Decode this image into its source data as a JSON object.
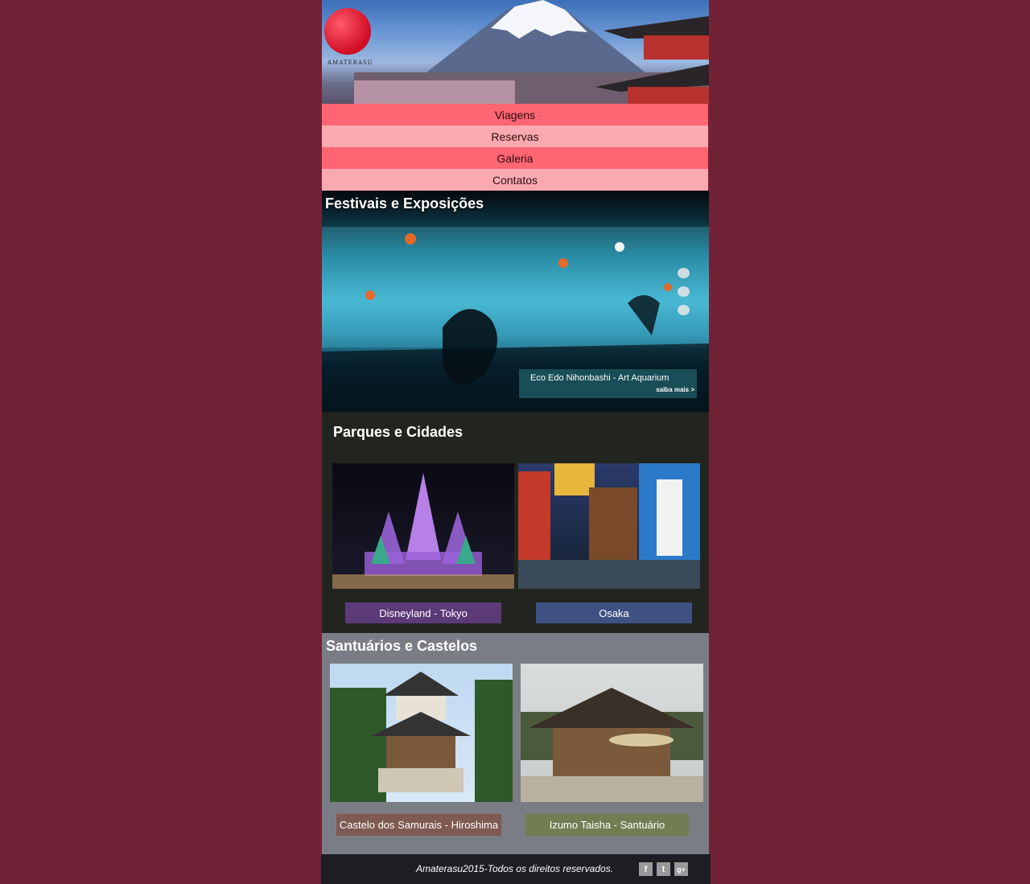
{
  "header": {
    "logo_text": "AMATERASU"
  },
  "nav": [
    {
      "label": "Viagens"
    },
    {
      "label": "Reservas"
    },
    {
      "label": "Galeria"
    },
    {
      "label": "Contatos"
    }
  ],
  "festivals": {
    "title": "Festivais e Exposições",
    "caption_title": "Eco Edo Nihonbashi - Art Aquarium",
    "caption_link": "saiba mais >"
  },
  "parks": {
    "title": "Parques e Cidades",
    "items": [
      {
        "label": "Disneyland - Tokyo",
        "color": "#5c3a78"
      },
      {
        "label": "Osaka",
        "color": "#3e5182"
      }
    ]
  },
  "shrines": {
    "title": "Santuários e Castelos",
    "items": [
      {
        "label": "Castelo dos Samurais - Hiroshima",
        "color": "#7e5a52"
      },
      {
        "label": "Izumo Taisha - Santuário",
        "color": "#717e53"
      }
    ]
  },
  "footer": {
    "copyright": "Amaterasu2015-Todos os direitos reservados.",
    "social": [
      "f",
      "t",
      "g+"
    ]
  },
  "colors": {
    "page_bg": "#722236",
    "nav_dark": "#ff6572",
    "nav_light": "#fba9b0",
    "parks_bg": "#22251f",
    "shrines_bg": "#7b7d85",
    "footer_bg": "#1d1d24"
  }
}
